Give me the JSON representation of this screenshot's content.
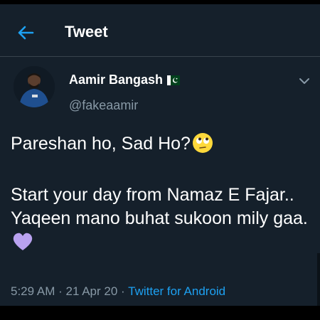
{
  "header": {
    "title": "Tweet",
    "back_icon": "arrow-left-icon"
  },
  "author": {
    "name": "Aamir Bangash",
    "handle": "@fakeaamir",
    "flag_icon": "pakistan-flag-icon"
  },
  "tweet": {
    "line1": "Pareshan ho, Sad Ho?",
    "line1_emoji": "face-with-rolling-eyes",
    "line2": "Start your day from Namaz E Fajar..",
    "line3": "Yaqeen mano buhat sukoon mily gaa.",
    "line3_emoji": "purple-heart"
  },
  "meta": {
    "time": "5:29 AM",
    "date": "21 Apr 20",
    "separator": "·",
    "source": "Twitter for Android"
  },
  "colors": {
    "background": "#15202b",
    "accent": "#1da1f2",
    "secondary_text": "#8899a6",
    "divider": "#38444d"
  }
}
